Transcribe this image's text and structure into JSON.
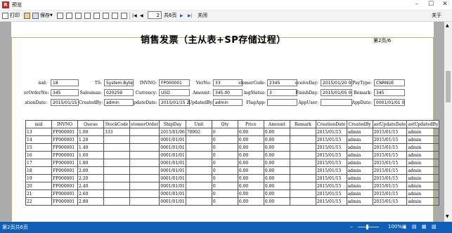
{
  "window": {
    "title": "预览",
    "app_icon": "R"
  },
  "toolbar": {
    "print_label": "打印",
    "save_label": "保存",
    "page_value": "2",
    "page_total": "共6页",
    "close_label": "关闭",
    "about_label": "关于"
  },
  "document": {
    "title": "销售发票（主从表+SP存储过程）",
    "page_info": "第2页/6"
  },
  "fields": [
    {
      "label": "isid:",
      "value": "18"
    },
    {
      "label": "TS:",
      "value": "System.Byte[]"
    },
    {
      "label": "INVNO:",
      "value": "FP000001"
    },
    {
      "label": "VerNo:",
      "value": "33"
    },
    {
      "label": "stomerCode:",
      "value": "2345"
    },
    {
      "label": "eceiveDay:",
      "value": "2015/01/20 00"
    },
    {
      "label": "PayType:",
      "value": "CNRNUE"
    },
    {
      "label": "erOrderNo:",
      "value": "345"
    },
    {
      "label": "Salesman:",
      "value": "020259"
    },
    {
      "label": "Currency:",
      "value": "USD"
    },
    {
      "label": "Amount:",
      "value": "345.00"
    },
    {
      "label": "ingStatus:",
      "value": "3"
    },
    {
      "label": "FinishDay:",
      "value": "2015/01/05 00"
    },
    {
      "label": "Remark:",
      "value": "345"
    },
    {
      "label": "ationDate:",
      "value": "2015/01/15 22"
    },
    {
      "label": "CreatedBy:",
      "value": "admin"
    },
    {
      "label": "pdateDate:",
      "value": "2015/01/15 22"
    },
    {
      "label": "UpdatedBy:",
      "value": "admin"
    },
    {
      "label": "FlagApp:",
      "value": ""
    },
    {
      "label": "AppUser:",
      "value": ""
    },
    {
      "label": "AppDate:",
      "value": "0001/01/01 00"
    }
  ],
  "table": {
    "headers": [
      "isid",
      "INVNO",
      "Queue",
      "StockCode",
      "stomerOrder",
      "ShipDay",
      "Unit",
      "Qty",
      "Price",
      "Amount",
      "Remark",
      "CreationDate",
      "CreatedBy",
      "astUpdateDate",
      "astUpdatedBy"
    ],
    "rows": [
      [
        "13",
        "FP000001",
        "1.00",
        "333",
        "",
        "2015/01/06",
        "70002",
        "0",
        "0.00",
        "0.00",
        "",
        "2015/01/15",
        "admin",
        "2015/01/15",
        "admin"
      ],
      [
        "14",
        "FP000001",
        "1.20",
        "",
        "",
        "0001/01/01",
        "",
        "0",
        "0.00",
        "0.00",
        "",
        "2015/01/15",
        "admin",
        "2015/01/15",
        "admin"
      ],
      [
        "15",
        "FP000001",
        "1.40",
        "",
        "",
        "0001/01/01",
        "",
        "0",
        "0.00",
        "0.00",
        "",
        "2015/01/15",
        "admin",
        "2015/01/15",
        "admin"
      ],
      [
        "16",
        "FP000001",
        "1.60",
        "",
        "",
        "0001/01/01",
        "",
        "0",
        "0.00",
        "0.00",
        "",
        "2015/01/15",
        "admin",
        "2015/01/15",
        "admin"
      ],
      [
        "17",
        "FP000001",
        "1.80",
        "",
        "",
        "0001/01/01",
        "",
        "0",
        "0.00",
        "0.00",
        "",
        "2015/01/15",
        "admin",
        "2015/01/15",
        "admin"
      ],
      [
        "18",
        "FP000001",
        "2.00",
        "",
        "",
        "0001/01/01",
        "",
        "0",
        "0.00",
        "0.00",
        "",
        "2015/01/15",
        "admin",
        "2015/01/15",
        "admin"
      ],
      [
        "19",
        "FP000001",
        "2.20",
        "",
        "",
        "0001/01/01",
        "",
        "0",
        "0.00",
        "0.00",
        "",
        "2015/01/15",
        "admin",
        "2015/01/15",
        "admin"
      ],
      [
        "20",
        "FP000001",
        "2.40",
        "",
        "",
        "0001/01/01",
        "",
        "0",
        "0.00",
        "0.00",
        "",
        "2015/01/15",
        "admin",
        "2015/01/15",
        "admin"
      ],
      [
        "21",
        "FP000001",
        "2.60",
        "",
        "",
        "0001/01/01",
        "",
        "0",
        "0.00",
        "0.00",
        "",
        "2015/01/15",
        "admin",
        "2015/01/15",
        "admin"
      ],
      [
        "22",
        "FP000001",
        "2.80",
        "",
        "",
        "0001/01/01",
        "",
        "0",
        "0.00",
        "0.00",
        "",
        "2015/01/15",
        "admin",
        "2015/01/15",
        "admin"
      ]
    ]
  },
  "status": {
    "page_text": "第2页共6页",
    "zoom": "100%"
  }
}
